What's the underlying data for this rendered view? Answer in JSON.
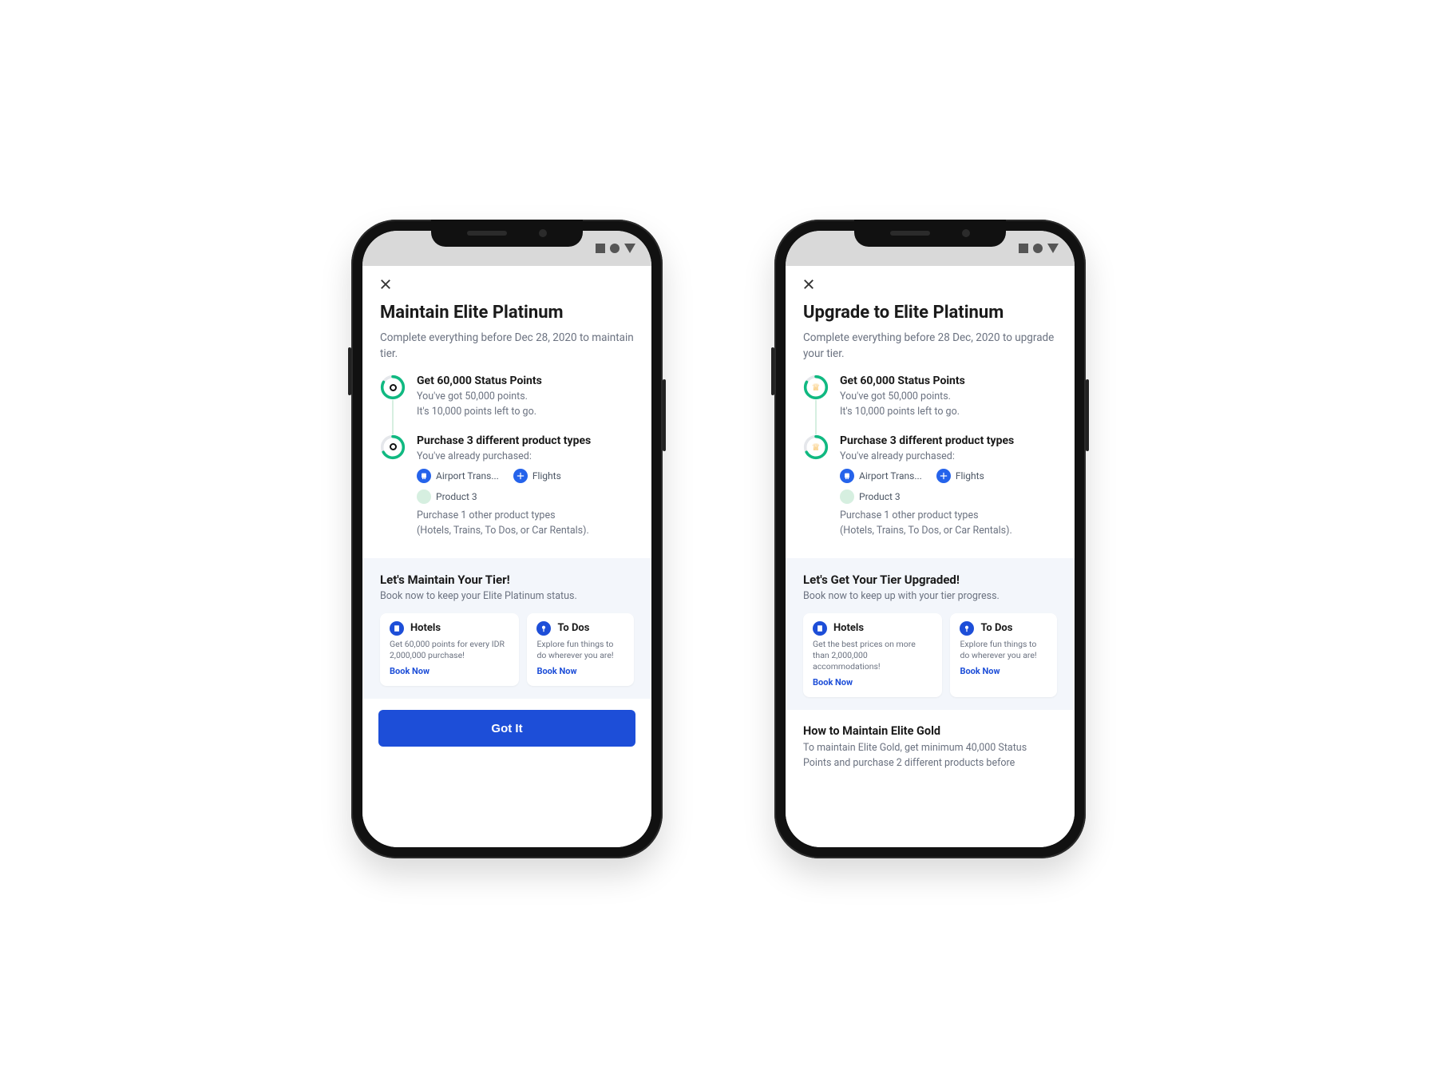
{
  "common": {
    "step1_title": "Get 60,000 Status Points",
    "step1_line1": "You've got 50,000 points.",
    "step1_line2": "It's 10,000 points left to go.",
    "step2_title": "Purchase 3 different product types",
    "step2_line1": "You've already purchased:",
    "step2_note1": "Purchase 1 other product types",
    "step2_note2": "(Hotels, Trains, To Dos, or Car Rentals).",
    "chip_airport": "Airport Trans...",
    "chip_flights": "Flights",
    "chip_product3": "Product 3",
    "card_hotels": "Hotels",
    "card_todos": "To Dos",
    "card_todos_desc": "Explore fun things to do wherever you are!",
    "book_now": "Book Now"
  },
  "left": {
    "title": "Maintain Elite Platinum",
    "subtitle": "Complete everything before Dec 28, 2020 to maintain tier.",
    "promo_title": "Let's Maintain Your Tier!",
    "promo_sub": "Book now to keep your Elite Platinum status.",
    "hotels_desc": "Get 60,000 points for every IDR 2,000,000 purchase!",
    "cta": "Got It"
  },
  "right": {
    "title": "Upgrade to Elite Platinum",
    "subtitle": "Complete everything before 28 Dec, 2020 to upgrade your tier.",
    "promo_title": "Let's Get Your Tier Upgraded!",
    "promo_sub": "Book now to keep up with your tier progress.",
    "hotels_desc": "Get the best prices on more than 2,000,000 accommodations!",
    "note_title": "How to Maintain Elite Gold",
    "note_body": "To maintain Elite Gold, get minimum 40,000 Status Points and purchase 2 different products before"
  },
  "colors": {
    "ring_green": "#10b981",
    "ring_gray": "#e5e7eb",
    "ring_amber": "#f59e0b"
  }
}
